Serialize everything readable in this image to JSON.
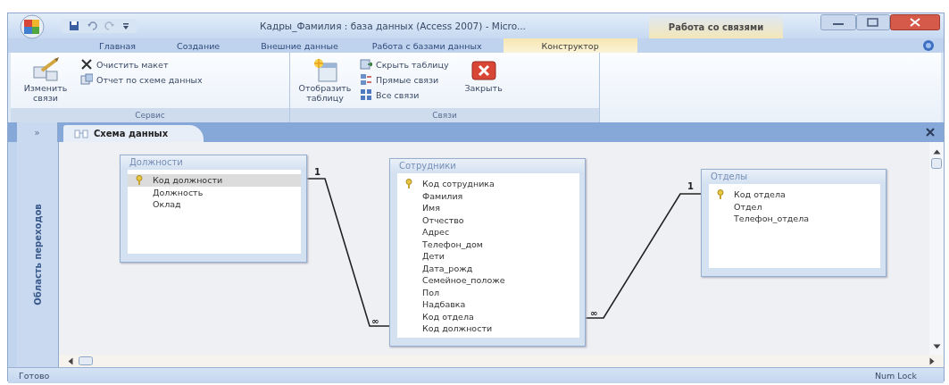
{
  "window": {
    "title": "Кадры_Фамилия : база данных (Access 2007) - Micro...",
    "context_group": "Работа со связями"
  },
  "ribbon_tabs": [
    {
      "label": "Главная",
      "selected": false
    },
    {
      "label": "Создание",
      "selected": false
    },
    {
      "label": "Внешние данные",
      "selected": false
    },
    {
      "label": "Работа с базами данных",
      "selected": false
    },
    {
      "label": "Конструктор",
      "selected": true
    }
  ],
  "ribbon_groups": [
    {
      "label": "Сервис",
      "buttons": [
        {
          "label": "Изменить связи",
          "kind": "large"
        },
        {
          "label": "Очистить макет",
          "kind": "small"
        },
        {
          "label": "Отчет по схеме данных",
          "kind": "small"
        }
      ]
    },
    {
      "label": "Связи",
      "buttons": [
        {
          "label": "Отобразить таблицу",
          "kind": "large"
        },
        {
          "label": "Скрыть таблицу",
          "kind": "small"
        },
        {
          "label": "Прямые связи",
          "kind": "small"
        },
        {
          "label": "Все связи",
          "kind": "small"
        },
        {
          "label": "Закрыть",
          "kind": "large"
        }
      ]
    }
  ],
  "nav_pane": {
    "toggle": "»",
    "title": "Область переходов"
  },
  "document_tab": {
    "label": "Схема данных",
    "selected": true
  },
  "tables": [
    {
      "name": "Должности",
      "fields": [
        {
          "name": "Код должности",
          "primary_key": true,
          "selected": true
        },
        {
          "name": "Должность",
          "primary_key": false,
          "selected": false
        },
        {
          "name": "Оклад",
          "primary_key": false,
          "selected": false
        }
      ]
    },
    {
      "name": "Сотрудники",
      "fields": [
        {
          "name": "Код сотрудника",
          "primary_key": true,
          "selected": false
        },
        {
          "name": "Фамилия",
          "primary_key": false,
          "selected": false
        },
        {
          "name": "Имя",
          "primary_key": false,
          "selected": false
        },
        {
          "name": "Отчество",
          "primary_key": false,
          "selected": false
        },
        {
          "name": "Адрес",
          "primary_key": false,
          "selected": false
        },
        {
          "name": "Телефон_дом",
          "primary_key": false,
          "selected": false
        },
        {
          "name": "Дети",
          "primary_key": false,
          "selected": false
        },
        {
          "name": "Дата_рожд",
          "primary_key": false,
          "selected": false
        },
        {
          "name": "Семейное_положе",
          "primary_key": false,
          "selected": false
        },
        {
          "name": "Пол",
          "primary_key": false,
          "selected": false
        },
        {
          "name": "Надбавка",
          "primary_key": false,
          "selected": false
        },
        {
          "name": "Код отдела",
          "primary_key": false,
          "selected": false
        },
        {
          "name": "Код должности",
          "primary_key": false,
          "selected": false
        }
      ]
    },
    {
      "name": "Отделы",
      "fields": [
        {
          "name": "Код отдела",
          "primary_key": true,
          "selected": false
        },
        {
          "name": "Отдел",
          "primary_key": false,
          "selected": false
        },
        {
          "name": "Телефон_отдела",
          "primary_key": false,
          "selected": false
        }
      ]
    }
  ],
  "relationships": [
    {
      "one_label": "1",
      "many_label": "∞"
    },
    {
      "one_label": "1",
      "many_label": "∞"
    }
  ],
  "status_bar": {
    "left": "Готово",
    "right": "Num Lock"
  }
}
